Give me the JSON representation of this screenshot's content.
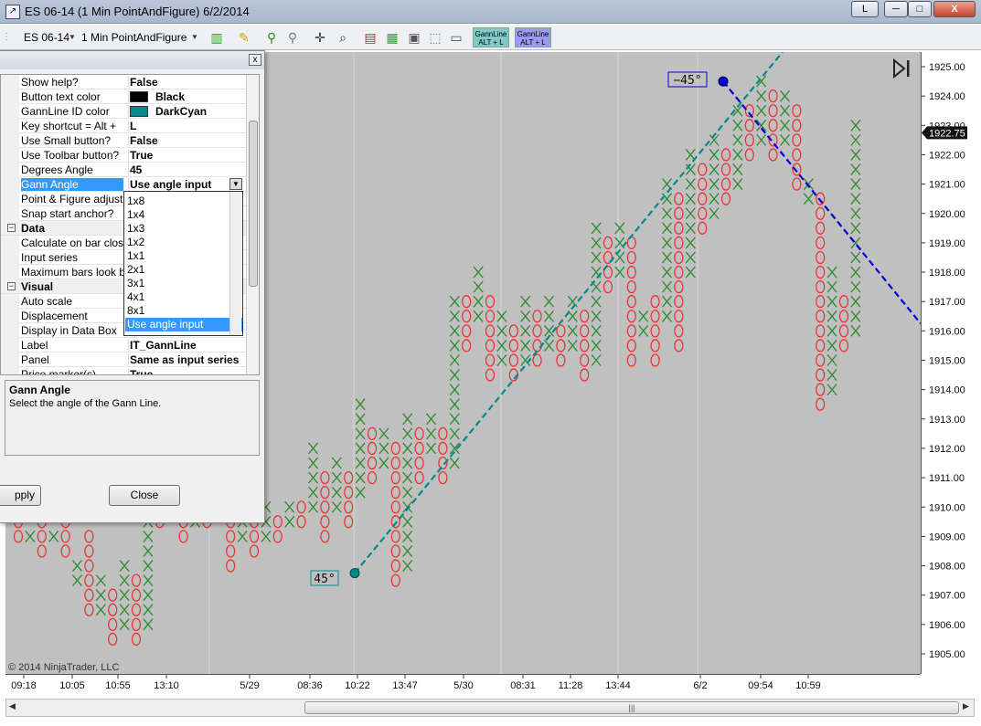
{
  "window": {
    "title": "ES 06-14 (1 Min PointAndFigure)  6/2/2014",
    "btn_l": "L",
    "btn_min": "─",
    "btn_max": "□",
    "btn_close": "X"
  },
  "toolbar": {
    "instrument": "ES 06-14",
    "period": "1 Min PointAndFigure",
    "gann1_line1": "GannLine",
    "gann1_line2": "ALT + L",
    "gann2_line1": "GannLine",
    "gann2_line2": "ALT + L"
  },
  "dialog": {
    "close_x": "x",
    "rows": [
      {
        "name": "Show help?",
        "value": "False"
      },
      {
        "name": "Button text color",
        "value": "Black",
        "swatch": "#000000"
      },
      {
        "name": "GannLine ID color",
        "value": "DarkCyan",
        "swatch": "#008b8b"
      },
      {
        "name": "Key shortcut = Alt +",
        "value": "L"
      },
      {
        "name": "Use Small button?",
        "value": "False"
      },
      {
        "name": "Use Toolbar button?",
        "value": "True"
      },
      {
        "name": "Degrees Angle",
        "value": "45"
      },
      {
        "name": "Gann Angle",
        "value": "Use angle input"
      },
      {
        "name": "Point & Figure adjust?",
        "value": ""
      },
      {
        "name": "Snap start anchor?",
        "value": ""
      },
      {
        "name": "Data",
        "value": ""
      },
      {
        "name": "Calculate on bar close",
        "value": ""
      },
      {
        "name": "Input series",
        "value": ""
      },
      {
        "name": "Maximum bars look back",
        "value": ""
      },
      {
        "name": "Visual",
        "value": ""
      },
      {
        "name": "Auto scale",
        "value": ""
      },
      {
        "name": "Displacement",
        "value": ""
      },
      {
        "name": "Display in Data Box",
        "value": ""
      },
      {
        "name": "Label",
        "value": "IT_GannLine"
      },
      {
        "name": "Panel",
        "value": "Same as input series"
      },
      {
        "name": "Price marker(s)",
        "value": "True"
      }
    ],
    "dropdown_options": [
      "1x8",
      "1x4",
      "1x3",
      "1x2",
      "1x1",
      "2x1",
      "3x1",
      "4x1",
      "8x1",
      "Use angle input"
    ],
    "help_title": "Gann Angle",
    "help_desc": "Select the angle of the Gann Line.",
    "apply_label": "pply",
    "close_label": "Close"
  },
  "chart": {
    "copyright": "© 2014 NinjaTrader, LLC",
    "angle_label_up": "45°",
    "angle_label_down": "−45°",
    "current_price": "1922.75",
    "price_ticks": [
      "1925.00",
      "1924.00",
      "1923.00",
      "1922.00",
      "1921.00",
      "1920.00",
      "1919.00",
      "1918.00",
      "1917.00",
      "1916.00",
      "1915.00",
      "1914.00",
      "1913.00",
      "1912.00",
      "1911.00",
      "1910.00",
      "1909.00",
      "1908.00",
      "1907.00",
      "1906.00",
      "1905.00"
    ],
    "time_ticks": [
      "09:18",
      "10:05",
      "10:55",
      "13:10",
      "5/29",
      "08:36",
      "10:22",
      "13:47",
      "5/30",
      "08:31",
      "11:28",
      "13:44",
      "6/2",
      "09:54",
      "10:59"
    ],
    "colors": {
      "x": "#2e8b2e",
      "o": "#ee3333",
      "up_line": "#008b8b",
      "down_line": "#0000dd"
    }
  },
  "chart_data": {
    "type": "point-and-figure",
    "columns": [
      {
        "kind": "O",
        "high": 1910.0,
        "low": 1909.0
      },
      {
        "kind": "X",
        "high": 1909.0,
        "low": 1909.0
      },
      {
        "kind": "O",
        "high": 1910.0,
        "low": 1908.5
      },
      {
        "kind": "X",
        "high": 1909.0,
        "low": 1909.0
      },
      {
        "kind": "O",
        "high": 1909.5,
        "low": 1908.5
      },
      {
        "kind": "X",
        "high": 1908.0,
        "low": 1907.5
      },
      {
        "kind": "O",
        "high": 1909.0,
        "low": 1906.5
      },
      {
        "kind": "X",
        "high": 1907.5,
        "low": 1906.5
      },
      {
        "kind": "O",
        "high": 1907.0,
        "low": 1905.5
      },
      {
        "kind": "X",
        "high": 1908.0,
        "low": 1906.0
      },
      {
        "kind": "O",
        "high": 1907.5,
        "low": 1905.5
      },
      {
        "kind": "X",
        "high": 1909.5,
        "low": 1906.0
      },
      {
        "kind": "O",
        "high": 1910.0,
        "low": 1909.5
      },
      {
        "kind": "X",
        "high": 1910.0,
        "low": 1910.0
      },
      {
        "kind": "O",
        "high": 1910.0,
        "low": 1909.0
      },
      {
        "kind": "X",
        "high": 1910.5,
        "low": 1909.5
      },
      {
        "kind": "O",
        "high": 1910.0,
        "low": 1909.5
      },
      {
        "kind": "X",
        "high": 1910.0,
        "low": 1910.0
      },
      {
        "kind": "O",
        "high": 1910.0,
        "low": 1908.0
      },
      {
        "kind": "X",
        "high": 1909.5,
        "low": 1909.0
      },
      {
        "kind": "O",
        "high": 1910.0,
        "low": 1908.5
      },
      {
        "kind": "X",
        "high": 1910.0,
        "low": 1909.0
      },
      {
        "kind": "O",
        "high": 1909.5,
        "low": 1909.0
      },
      {
        "kind": "X",
        "high": 1910.0,
        "low": 1909.5
      },
      {
        "kind": "O",
        "high": 1910.0,
        "low": 1909.5
      },
      {
        "kind": "X",
        "high": 1912.0,
        "low": 1910.0
      },
      {
        "kind": "O",
        "high": 1911.0,
        "low": 1909.0
      },
      {
        "kind": "X",
        "high": 1911.5,
        "low": 1910.0
      },
      {
        "kind": "O",
        "high": 1911.0,
        "low": 1909.5
      },
      {
        "kind": "X",
        "high": 1913.5,
        "low": 1910.5
      },
      {
        "kind": "O",
        "high": 1912.5,
        "low": 1911.0
      },
      {
        "kind": "X",
        "high": 1912.5,
        "low": 1911.5
      },
      {
        "kind": "O",
        "high": 1912.0,
        "low": 1907.5
      },
      {
        "kind": "X",
        "high": 1913.0,
        "low": 1908.0
      },
      {
        "kind": "O",
        "high": 1912.5,
        "low": 1911.0
      },
      {
        "kind": "X",
        "high": 1913.0,
        "low": 1912.0
      },
      {
        "kind": "O",
        "high": 1912.5,
        "low": 1911.0
      },
      {
        "kind": "X",
        "high": 1917.0,
        "low": 1911.5
      },
      {
        "kind": "O",
        "high": 1917.0,
        "low": 1915.5
      },
      {
        "kind": "X",
        "high": 1918.0,
        "low": 1916.5
      },
      {
        "kind": "O",
        "high": 1917.0,
        "low": 1914.5
      },
      {
        "kind": "X",
        "high": 1916.5,
        "low": 1915.0
      },
      {
        "kind": "O",
        "high": 1916.0,
        "low": 1914.5
      },
      {
        "kind": "X",
        "high": 1917.0,
        "low": 1915.0
      },
      {
        "kind": "O",
        "high": 1916.5,
        "low": 1915.0
      },
      {
        "kind": "X",
        "high": 1917.0,
        "low": 1915.5
      },
      {
        "kind": "O",
        "high": 1916.0,
        "low": 1915.0
      },
      {
        "kind": "X",
        "high": 1917.0,
        "low": 1915.5
      },
      {
        "kind": "O",
        "high": 1916.5,
        "low": 1914.5
      },
      {
        "kind": "X",
        "high": 1919.5,
        "low": 1915.0
      },
      {
        "kind": "O",
        "high": 1919.0,
        "low": 1917.5
      },
      {
        "kind": "X",
        "high": 1919.5,
        "low": 1918.0
      },
      {
        "kind": "O",
        "high": 1919.0,
        "low": 1915.0
      },
      {
        "kind": "X",
        "high": 1916.5,
        "low": 1916.0
      },
      {
        "kind": "O",
        "high": 1917.0,
        "low": 1915.0
      },
      {
        "kind": "X",
        "high": 1921.0,
        "low": 1916.5
      },
      {
        "kind": "O",
        "high": 1920.5,
        "low": 1915.5
      },
      {
        "kind": "X",
        "high": 1922.0,
        "low": 1918.0
      },
      {
        "kind": "O",
        "high": 1921.5,
        "low": 1919.5
      },
      {
        "kind": "X",
        "high": 1922.5,
        "low": 1920.0
      },
      {
        "kind": "O",
        "high": 1922.0,
        "low": 1920.5
      },
      {
        "kind": "X",
        "high": 1923.5,
        "low": 1921.0
      },
      {
        "kind": "O",
        "high": 1923.5,
        "low": 1922.0
      },
      {
        "kind": "X",
        "high": 1924.5,
        "low": 1922.5
      },
      {
        "kind": "O",
        "high": 1924.0,
        "low": 1922.0
      },
      {
        "kind": "X",
        "high": 1924.0,
        "low": 1922.5
      },
      {
        "kind": "O",
        "high": 1923.5,
        "low": 1921.0
      },
      {
        "kind": "X",
        "high": 1921.0,
        "low": 1920.5
      },
      {
        "kind": "O",
        "high": 1920.5,
        "low": 1913.5
      },
      {
        "kind": "X",
        "high": 1918.0,
        "low": 1914.0
      },
      {
        "kind": "O",
        "high": 1917.0,
        "low": 1915.5
      },
      {
        "kind": "X",
        "high": 1923.0,
        "low": 1916.0
      }
    ],
    "gann_up": {
      "angle": "45°",
      "start_price": 1907.75,
      "end_price": 1925.5
    },
    "gann_down": {
      "angle": "-45°",
      "start_price": 1924.5,
      "end_price": 1916.25
    },
    "ylim": [
      1904.5,
      1925.5
    ],
    "ytick_step": 1.0
  }
}
